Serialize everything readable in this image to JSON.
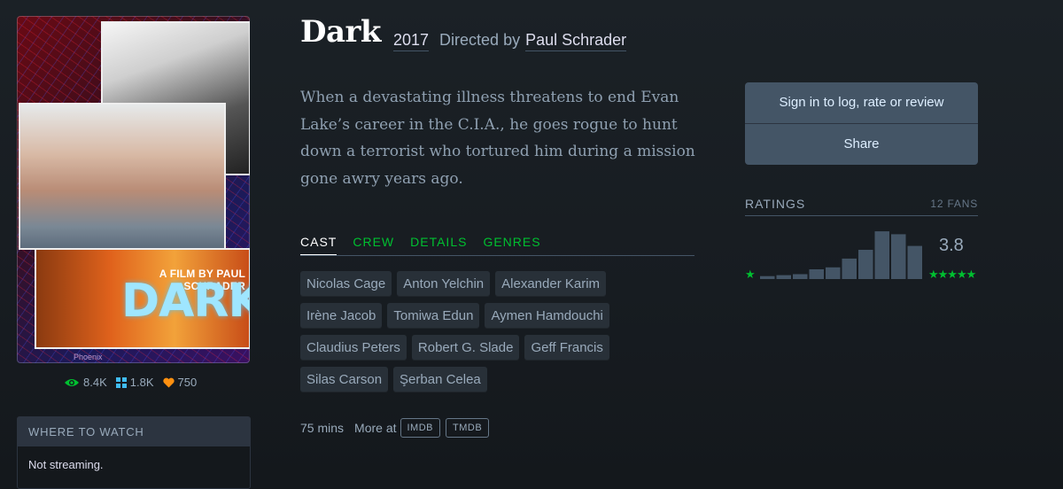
{
  "film": {
    "title": "Dark",
    "year": "2017",
    "directed_by_label": "Directed by",
    "director": "Paul Schrader",
    "synopsis": "When a devastating illness threatens to end Evan Lake’s career in the C.I.A., he goes rogue to hunt down a terrorist who tortured him during a mission gone awry years ago."
  },
  "poster": {
    "tagline": "A FILM BY PAUL SCHRADER",
    "title_art": "DARK",
    "map_label": "Phoenix"
  },
  "stats": {
    "watched": "8.4K",
    "lists": "1.8K",
    "likes": "750"
  },
  "where_to_watch": {
    "header": "WHERE TO WATCH",
    "status": "Not streaming."
  },
  "tabs": [
    {
      "label": "CAST",
      "active": true
    },
    {
      "label": "CREW",
      "active": false
    },
    {
      "label": "DETAILS",
      "active": false
    },
    {
      "label": "GENRES",
      "active": false
    }
  ],
  "cast": [
    "Nicolas Cage",
    "Anton Yelchin",
    "Alexander Karim",
    "Irène Jacob",
    "Tomiwa Edun",
    "Aymen Hamdouchi",
    "Claudius Peters",
    "Robert G. Slade",
    "Geff Francis",
    "Silas Carson",
    "Şerban Celea"
  ],
  "footer_meta": {
    "runtime": "75 mins",
    "more_at": "More at",
    "imdb": "IMDB",
    "tmdb": "TMDB"
  },
  "actions": {
    "sign_in": "Sign in to log, rate or review",
    "share": "Share"
  },
  "ratings": {
    "label": "RATINGS",
    "fans": "12 FANS",
    "average": "3.8",
    "min_stars": "★",
    "max_stars": "★★★★★",
    "histogram": [
      0.06,
      0.08,
      0.1,
      0.2,
      0.24,
      0.42,
      0.6,
      0.98,
      0.92,
      0.68
    ]
  },
  "colors": {
    "accent_green": "#00c030",
    "background": "#14181c",
    "panel": "#456"
  }
}
